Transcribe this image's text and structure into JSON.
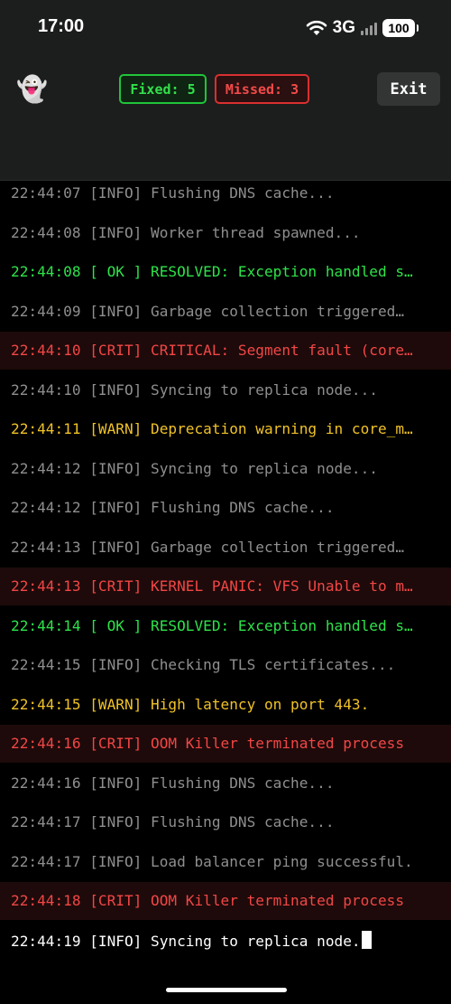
{
  "status_bar": {
    "time": "17:00",
    "network": "3G",
    "battery": "100"
  },
  "header": {
    "ghost_emoji": "👻",
    "fixed_label": "Fixed: 5",
    "missed_label": "Missed: 3",
    "exit_label": "Exit"
  },
  "colors": {
    "info": "#8f8f8f",
    "ok": "#2ee34a",
    "warn": "#f0c228",
    "crit": "#f24646",
    "current": "#ffffff"
  },
  "log": [
    {
      "level": "info",
      "text": "22:44:07 [INFO] Flushing DNS cache..."
    },
    {
      "level": "info",
      "text": "22:44:08 [INFO] Worker thread spawned..."
    },
    {
      "level": "ok",
      "text": "22:44:08 [ OK ] RESOLVED: Exception handled s…"
    },
    {
      "level": "info",
      "text": "22:44:09 [INFO] Garbage collection triggered…"
    },
    {
      "level": "crit",
      "text": "22:44:10 [CRIT] CRITICAL: Segment fault (core…"
    },
    {
      "level": "info",
      "text": "22:44:10 [INFO] Syncing to replica node..."
    },
    {
      "level": "warn",
      "text": "22:44:11 [WARN] Deprecation warning in core_m…"
    },
    {
      "level": "info",
      "text": "22:44:12 [INFO] Syncing to replica node..."
    },
    {
      "level": "info",
      "text": "22:44:12 [INFO] Flushing DNS cache..."
    },
    {
      "level": "info",
      "text": "22:44:13 [INFO] Garbage collection triggered…"
    },
    {
      "level": "crit",
      "text": "22:44:13 [CRIT] KERNEL PANIC: VFS Unable to m…"
    },
    {
      "level": "ok",
      "text": "22:44:14 [ OK ] RESOLVED: Exception handled s…"
    },
    {
      "level": "info",
      "text": "22:44:15 [INFO] Checking TLS certificates..."
    },
    {
      "level": "warn",
      "text": "22:44:15 [WARN] High latency on port 443."
    },
    {
      "level": "crit",
      "text": "22:44:16 [CRIT] OOM Killer terminated process"
    },
    {
      "level": "info",
      "text": "22:44:16 [INFO] Flushing DNS cache..."
    },
    {
      "level": "info",
      "text": "22:44:17 [INFO] Flushing DNS cache..."
    },
    {
      "level": "info",
      "text": "22:44:17 [INFO] Load balancer ping successful."
    },
    {
      "level": "crit",
      "text": "22:44:18 [CRIT] OOM Killer terminated process"
    },
    {
      "level": "current",
      "text": "22:44:19 [INFO] Syncing to replica node."
    }
  ]
}
